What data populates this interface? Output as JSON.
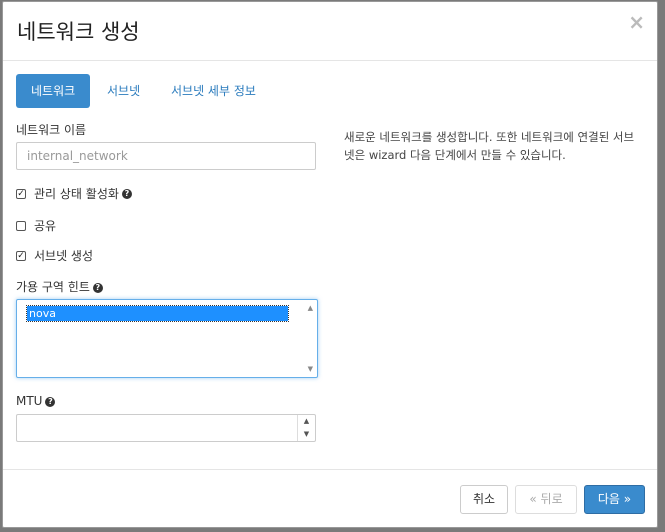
{
  "modal": {
    "title": "네트워크 생성",
    "close": "×"
  },
  "tabs": [
    {
      "label": "네트워크",
      "active": true
    },
    {
      "label": "서브넷",
      "active": false
    },
    {
      "label": "서브넷 세부 정보",
      "active": false
    }
  ],
  "form": {
    "network_name_label": "네트워크 이름",
    "network_name_placeholder": "internal_network",
    "admin_state_label": "관리 상태 활성화",
    "admin_state_checked": true,
    "shared_label": "공유",
    "shared_checked": false,
    "create_subnet_label": "서브넷 생성",
    "create_subnet_checked": true,
    "az_hint_label": "가용 구역 힌트",
    "az_options": [
      "nova"
    ],
    "mtu_label": "MTU",
    "mtu_value": ""
  },
  "help_text": "새로운 네트워크를 생성합니다. 또한 네트워크에 연결된 서브넷은 wizard 다음 단계에서 만들 수 있습니다.",
  "footer": {
    "cancel": "취소",
    "back": "« 뒤로",
    "next": "다음 »"
  },
  "colors": {
    "primary": "#3a8bcd",
    "link": "#2a7bbd",
    "selection": "#1e90ff"
  },
  "icons": {
    "close": "close-icon",
    "help": "question-circle-icon",
    "check": "checkmark-icon"
  }
}
